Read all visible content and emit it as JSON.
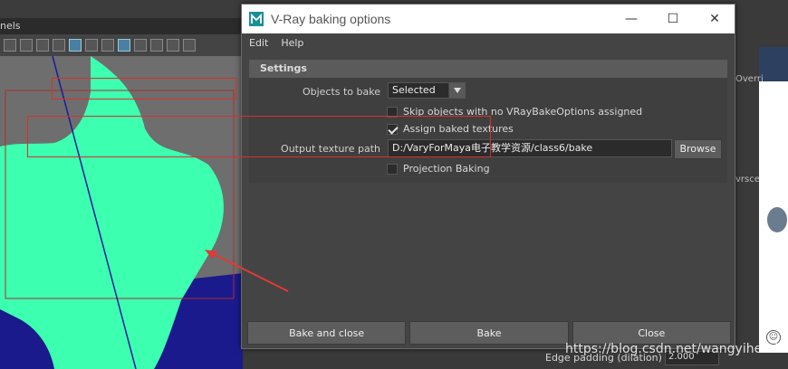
{
  "background": {
    "panels_label": "nels",
    "right_labels": [
      "Overri",
      "vrsce"
    ],
    "edge_padding_label": "Edge padding (dilation)",
    "edge_padding_value": "2.000",
    "watermark": "https://blog.csdn.net/wangyiheroi",
    "mesh_color": "#3dffb0",
    "ground_color": "#1a1a8c"
  },
  "dialog": {
    "title": "V-Ray baking options",
    "window_buttons": {
      "minimize": "—",
      "maximize": "☐",
      "close": "✕"
    },
    "menu": [
      "Edit",
      "Help"
    ],
    "settings": {
      "header": "Settings",
      "objects_to_bake_label": "Objects to bake",
      "objects_to_bake_value": "Selected",
      "skip_objects_label": "Skip objects with no VRayBakeOptions assigned",
      "skip_objects_checked": false,
      "assign_baked_label": "Assign baked textures",
      "assign_baked_checked": true,
      "output_path_label": "Output texture path",
      "output_path_value": "D:/VaryForMaya电子教学资源/class6/bake",
      "browse_label": "Browse",
      "projection_label": "Projection Baking",
      "projection_checked": false
    },
    "buttons": [
      "Bake and close",
      "Bake",
      "Close"
    ],
    "highlight_color": "#d9302c"
  }
}
